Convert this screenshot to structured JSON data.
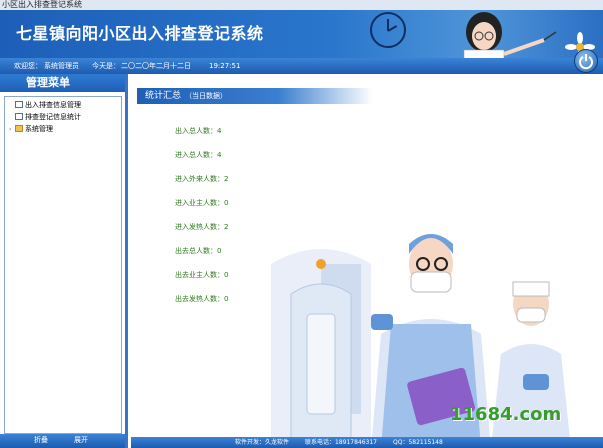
{
  "window": {
    "title": "小区出入排查登记系统"
  },
  "banner": {
    "title": "七星镇向阳小区出入排查登记系统"
  },
  "statusbar": {
    "welcome_label": "欢迎您：",
    "user": "系统管理员",
    "today_label": "今天是：",
    "date": "二〇二〇年二月十二日",
    "time": "19:27:51"
  },
  "sidebar": {
    "header": "管理菜单",
    "items": [
      {
        "label": "出入排查信息管理",
        "icon": "document-icon"
      },
      {
        "label": "排查登记信息统计",
        "icon": "document-icon"
      },
      {
        "label": "系统管理",
        "icon": "folder-icon"
      }
    ],
    "collapse_label": "折叠",
    "expand_label": "展开"
  },
  "panel": {
    "title": "统计汇总",
    "subtitle": "（当日数据）"
  },
  "stats": [
    {
      "label": "出入总人数：",
      "value": "4"
    },
    {
      "label": "进入总人数：",
      "value": "4"
    },
    {
      "label": "进入外来人数：",
      "value": "2"
    },
    {
      "label": "进入业主人数：",
      "value": "0"
    },
    {
      "label": "进入发热人数：",
      "value": "2"
    },
    {
      "label": "出去总人数：",
      "value": "0"
    },
    {
      "label": "出去业主人数：",
      "value": "0"
    },
    {
      "label": "出去发热人数：",
      "value": "0"
    }
  ],
  "footer": {
    "developer": "软件开发：久龙软件",
    "phone": "联系电话：18917846317",
    "qq": "QQ：582115148"
  },
  "watermark": "11684.com",
  "colors": {
    "accent": "#1f5fb6",
    "stat_text": "#2a7a1a",
    "watermark": "#3a9c2e"
  }
}
